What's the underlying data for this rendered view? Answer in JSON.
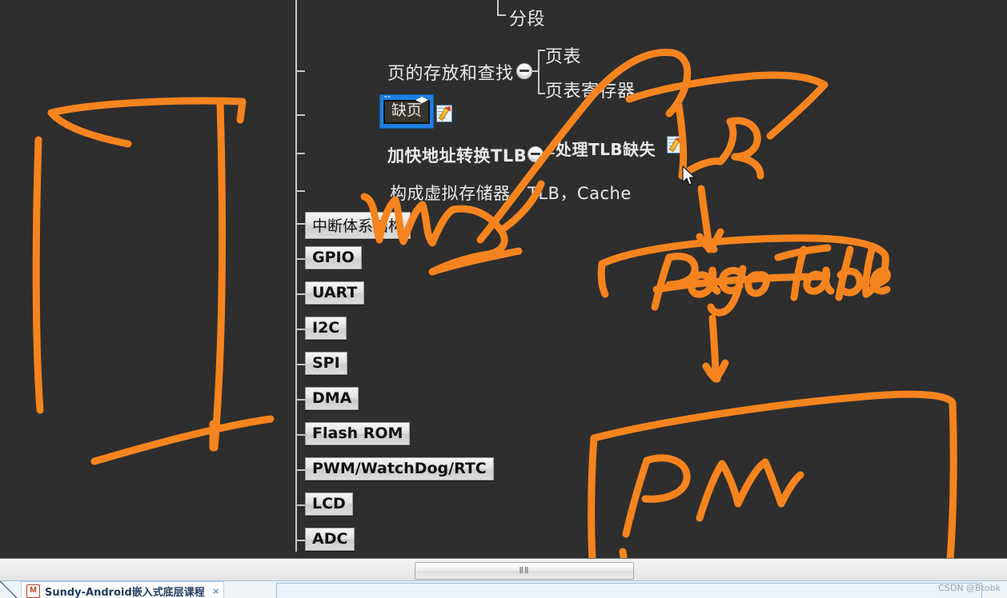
{
  "app": {
    "background_color": "#2e2e2e",
    "ink_color": "#F5841F"
  },
  "mindmap": {
    "topics": [
      {
        "id": "fenduan",
        "label": "分段"
      },
      {
        "id": "cunfang",
        "label": "页的存放和查找"
      },
      {
        "id": "yebiao",
        "label": "页表"
      },
      {
        "id": "yebiaojicun",
        "label": "页表寄存器"
      },
      {
        "id": "jiakuai",
        "label": "加快地址转换TLB"
      },
      {
        "id": "chuli",
        "label": "处理TLB缺失"
      },
      {
        "id": "gouchen",
        "label": "构成虚拟存储器，TLB，Cache"
      }
    ],
    "selected_node": {
      "label": "缺页",
      "quote_glyph": "””",
      "resize_glyph": "◀▶"
    },
    "collapse_buttons": [
      {
        "for": "页的存放和查找",
        "state": "expanded",
        "glyph": "minus"
      },
      {
        "for": "加快地址转换TLB",
        "state": "expanded",
        "glyph": "minus"
      }
    ],
    "button_nodes": [
      {
        "label": "中断体系结构",
        "cjk": true
      },
      {
        "label": "GPIO",
        "cjk": false
      },
      {
        "label": "UART",
        "cjk": false
      },
      {
        "label": "I2C",
        "cjk": false
      },
      {
        "label": "SPI",
        "cjk": false
      },
      {
        "label": "DMA",
        "cjk": false
      },
      {
        "label": "Flash ROM",
        "cjk": false
      },
      {
        "label": "PWM/WatchDog/RTC",
        "cjk": false
      },
      {
        "label": "LCD",
        "cjk": false
      },
      {
        "label": "ADC",
        "cjk": false
      }
    ],
    "annotations": [
      {
        "text": "TLB",
        "kind": "handwriting"
      },
      {
        "text": "Page Table",
        "kind": "handwriting"
      },
      {
        "text": "PM",
        "kind": "handwriting"
      }
    ]
  },
  "chrome": {
    "hscrollbar": {
      "grip_glyph": "‖‖",
      "thumb_position_percent": 41
    },
    "tab": {
      "icon_letter": "M",
      "title": "Sundy-Android嵌入式底层课程",
      "close_glyph": "×"
    },
    "watermark": "CSDN @Btobk"
  }
}
